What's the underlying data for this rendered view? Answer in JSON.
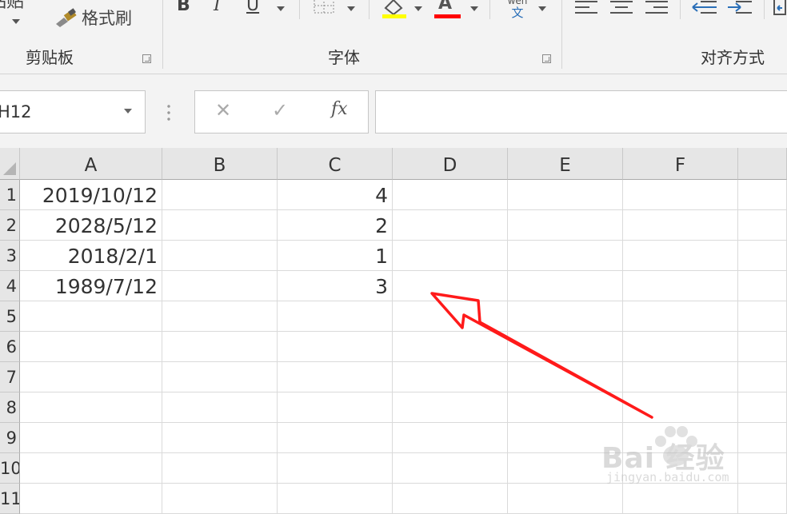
{
  "ribbon": {
    "paste_label": "粘贴",
    "format_painter_label": "格式刷",
    "clipboard_group": "剪贴板",
    "font_group": "字体",
    "align_group": "对齐方式",
    "bold": "B",
    "italic": "I",
    "underline": "U",
    "font_color": "A",
    "phonetic_top": "wén",
    "phonetic_bottom": "文",
    "highlight_color": "#ffff00",
    "font_color_value": "#ff0000"
  },
  "formula_bar": {
    "name_box": "H12",
    "cancel": "✕",
    "enter": "✓",
    "fx": "fx",
    "formula": ""
  },
  "sheet": {
    "columns": [
      "A",
      "B",
      "C",
      "D",
      "E",
      "F"
    ],
    "rows": [
      "1",
      "2",
      "3",
      "4",
      "5",
      "6",
      "7",
      "8",
      "9",
      "10",
      "11"
    ],
    "data": [
      {
        "A": "2019/10/12",
        "C": "4"
      },
      {
        "A": "2028/5/12",
        "C": "2"
      },
      {
        "A": "2018/2/1",
        "C": "1"
      },
      {
        "A": "1989/7/12",
        "C": "3"
      }
    ]
  },
  "annotation": {
    "arrow_color": "#ff1a1a"
  },
  "watermark": {
    "text": "Bai 经验",
    "url": "jingyan.baidu.com"
  }
}
